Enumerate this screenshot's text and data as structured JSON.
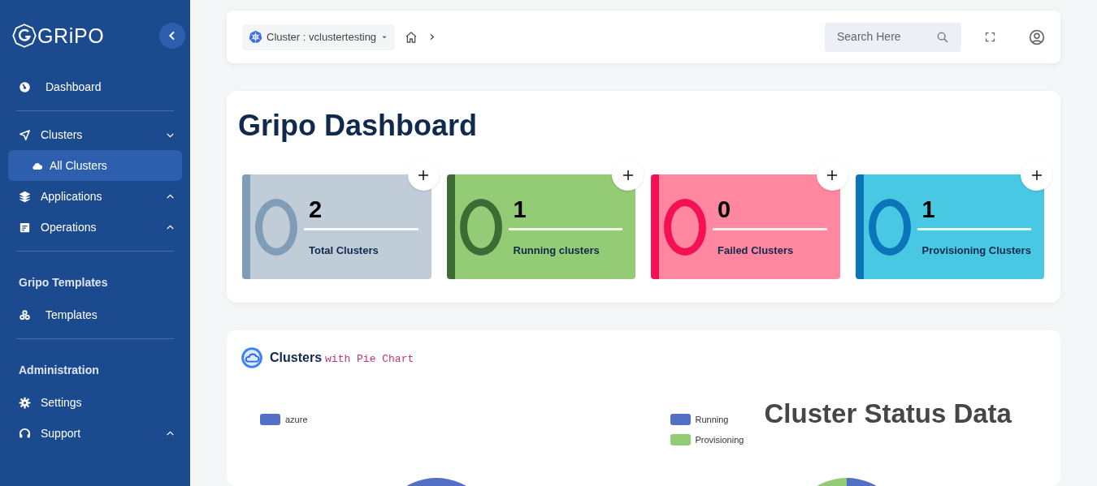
{
  "sidebar": {
    "logo": "GRiPO",
    "groups": [
      {
        "items": [
          {
            "label": "Dashboard",
            "selected": false
          }
        ]
      },
      {
        "items": [
          {
            "label": "Clusters",
            "selected": false,
            "expanded": true,
            "children": [
              {
                "label": "All Clusters",
                "selected": true
              }
            ]
          },
          {
            "label": "Applications",
            "selected": false,
            "expanded": false
          },
          {
            "label": "Operations",
            "selected": false,
            "expanded": false
          }
        ]
      },
      {
        "heading": "Gripo Templates",
        "items": [
          {
            "label": "Templates",
            "selected": false
          }
        ]
      },
      {
        "heading": "Administration",
        "items": [
          {
            "label": "Settings",
            "selected": false
          },
          {
            "label": "Support",
            "selected": false,
            "expanded": false
          }
        ]
      }
    ]
  },
  "topbar": {
    "cluster": "Cluster : vclustertesting",
    "search": {
      "placeholder": "Search Here"
    }
  },
  "title": "Gripo Dashboard",
  "stats": [
    {
      "kind": "total",
      "value": "2",
      "label": "Total Clusters"
    },
    {
      "kind": "running",
      "value": "1",
      "label": "Running clusters"
    },
    {
      "kind": "failed",
      "value": "0",
      "label": "Failed Clusters"
    },
    {
      "kind": "provisioning",
      "value": "1",
      "label": "Provisioning Clusters"
    }
  ],
  "charts_panel": {
    "title": "Clusters",
    "subtitle": "with Pie Chart",
    "charts": [
      {
        "chart_data": {
          "type": "pie",
          "categories": [
            "azure"
          ],
          "values": [
            100
          ],
          "legend": "top-left"
        }
      },
      {
        "chart_data": {
          "type": "pie",
          "title": "Cluster Status Data",
          "categories": [
            "Running",
            "Provisioning"
          ],
          "values": [
            50,
            50
          ],
          "legend": "top-left"
        }
      }
    ]
  }
}
